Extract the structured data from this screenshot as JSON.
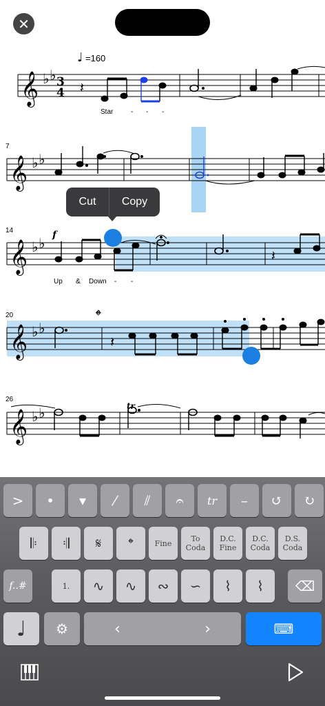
{
  "header": {
    "close_glyph": "✕"
  },
  "score": {
    "tempo": "=160",
    "measure_numbers": [
      "7",
      "14",
      "20",
      "26"
    ],
    "lyrics_line1": [
      "Star",
      "-",
      "-",
      "-"
    ],
    "lyrics_line3": [
      "Up",
      "&",
      "Down",
      "-",
      "-"
    ],
    "time_signature": [
      "3",
      "4"
    ],
    "dynamic": "f",
    "trill": "tr",
    "selection_color": "#a9d5f5",
    "handle_color": "#1a7fe0",
    "highlight_note_color": "#1f3fe6"
  },
  "context_menu": {
    "cut_label": "Cut",
    "copy_label": "Copy"
  },
  "keyboard": {
    "row1": [
      {
        "name": "accent-key",
        "glyph": ">"
      },
      {
        "name": "staccato-key",
        "glyph": "•"
      },
      {
        "name": "staccatissimo-key",
        "glyph": "▾"
      },
      {
        "name": "tremolo-1-key",
        "glyph": "⁄"
      },
      {
        "name": "tremolo-2-key",
        "glyph": "⫽"
      },
      {
        "name": "fermata-key",
        "glyph": "𝄐"
      },
      {
        "name": "trill-key",
        "glyph": "tr"
      },
      {
        "name": "tenuto-key",
        "glyph": "–"
      },
      {
        "name": "undo-key",
        "glyph": "↺"
      },
      {
        "name": "redo-key",
        "glyph": "↻"
      }
    ],
    "row2": [
      {
        "name": "repeat-start-key",
        "glyph": "𝄆"
      },
      {
        "name": "repeat-end-key",
        "glyph": "𝄇"
      },
      {
        "name": "segno-key",
        "glyph": "𝄋"
      },
      {
        "name": "coda-key",
        "glyph": "𝄌"
      },
      {
        "name": "fine-key",
        "glyph": "Fine"
      },
      {
        "name": "to-coda-key",
        "glyph": "To Coda"
      },
      {
        "name": "dc-fine-key",
        "glyph": "D.C. Fine"
      },
      {
        "name": "dc-coda-key",
        "glyph": "D.C. Coda"
      },
      {
        "name": "ds-coda-key",
        "glyph": "D.S. Coda"
      }
    ],
    "row3": [
      {
        "name": "dynamics-key",
        "glyph": "f..#"
      },
      {
        "name": "volta-key",
        "glyph": "1."
      },
      {
        "name": "mordent-key",
        "glyph": "∿"
      },
      {
        "name": "inverted-mordent-key",
        "glyph": "∿"
      },
      {
        "name": "turn-key",
        "glyph": "∾"
      },
      {
        "name": "inverted-turn-key",
        "glyph": "∽"
      },
      {
        "name": "arpeggio-up-key",
        "glyph": "⌇"
      },
      {
        "name": "arpeggio-down-key",
        "glyph": "⌇"
      },
      {
        "name": "backspace-key",
        "glyph": "⌫"
      }
    ],
    "row4": {
      "note_glyph": "♩",
      "settings_glyph": "⚙",
      "left_arrow": "‹",
      "right_arrow": "›",
      "hide_keyboard_glyph": "⌨"
    },
    "bottom": {
      "piano_glyph": "🎹",
      "play_glyph": "▷"
    }
  }
}
